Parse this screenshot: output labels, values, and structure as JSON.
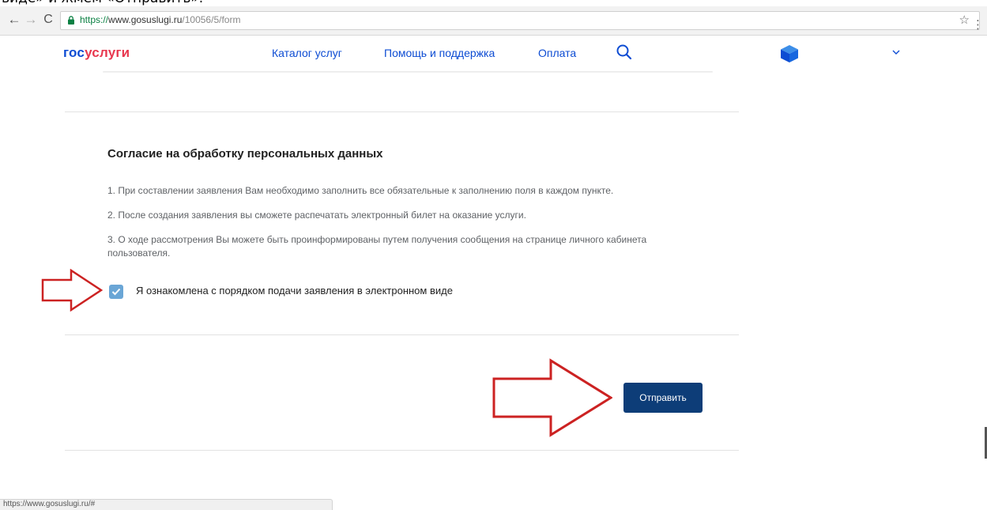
{
  "caption": "виде» и жмем «Отправить».",
  "browser": {
    "back": "←",
    "forward": "→",
    "reload": "C",
    "url_secure": "https://",
    "url_host": "www.gosuslugi.ru",
    "url_path": "/10056/5/form",
    "star": "☆",
    "menu": "⋮"
  },
  "header": {
    "logo_part1": "гос",
    "logo_part2": "услуги",
    "nav": [
      "Каталог услуг",
      "Помощь и поддержка",
      "Оплата"
    ],
    "colors": {
      "brand_blue": "#0d4cd3",
      "brand_red": "#e8384f"
    }
  },
  "consent": {
    "title": "Согласие на обработку персональных данных",
    "rules": [
      "1. При составлении заявления Вам необходимо заполнить все обязательные к заполнению поля в каждом пункте.",
      "2. После создания заявления вы сможете распечатать электронный билет на оказание услуги.",
      "3. О ходе рассмотрения Вы можете быть проинформированы путем получения сообщения на странице личного кабинета пользователя."
    ],
    "checkbox_label": "Я ознакомлена с порядком подачи заявления в электронном виде",
    "checkbox_checked": true
  },
  "form": {
    "submit_label": "Отправить"
  },
  "status_bar": {
    "text": "https://www.gosuslugi.ru/#"
  }
}
